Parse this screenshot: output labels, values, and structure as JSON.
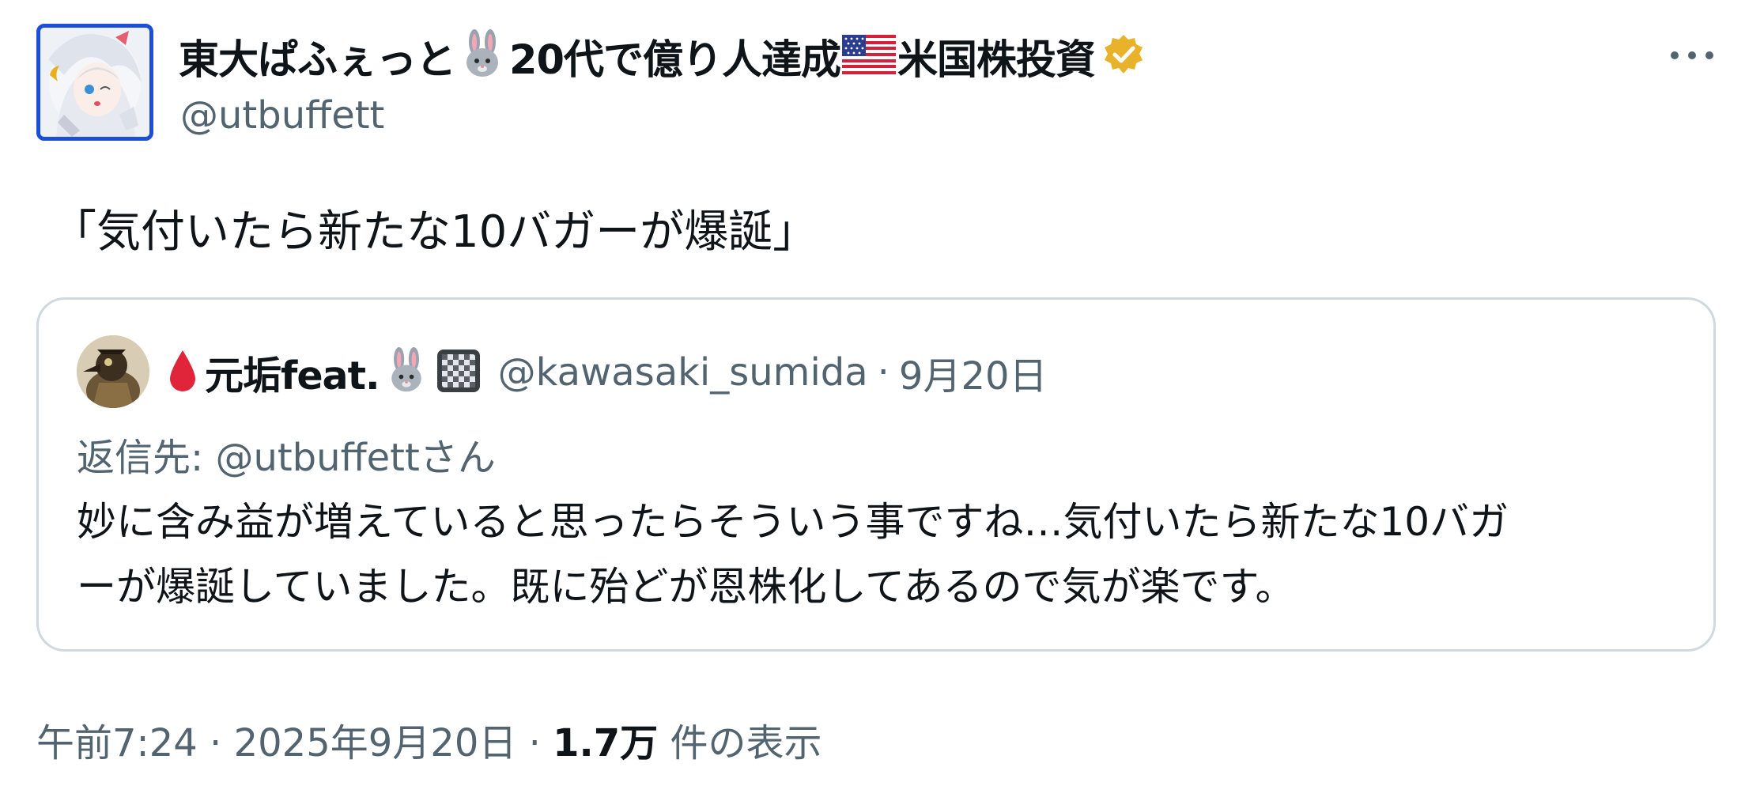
{
  "author": {
    "name_part1": "東大ぱふぇっと",
    "name_part2": "20代で億り人達成",
    "name_part3": "米国株投資",
    "handle": "@utbuffett",
    "avatar": "anime-girl-avatar",
    "verified_color": "#e8b22a"
  },
  "menu": {
    "more_label": "···"
  },
  "tweet": {
    "text": "「気付いたら新たな10バガーが爆誕」"
  },
  "quote": {
    "name": "元垢feat.",
    "handle": "@kawasaki_sumida",
    "separator": "·",
    "date": "9月20日",
    "reply_prefix": "返信先: ",
    "reply_handle": "@utbuffett",
    "reply_suffix": "さん",
    "body_line1": "妙に含み益が増えていると思ったらそういう事ですね…気付いたら新たな10バガ",
    "body_line2": "ーが爆誕していました。既に殆どが恩株化してあるので気が楽です。"
  },
  "meta": {
    "time": "午前7:24",
    "sep1": " · ",
    "date": "2025年9月20日",
    "sep2": " · ",
    "views_count": "1.7万",
    "views_label": " 件の表示"
  },
  "colors": {
    "text_primary": "#0f1419",
    "text_secondary": "#536471",
    "border": "#cfd9de",
    "avatar_border": "#1d4ed8",
    "drop_red": "#e0243a"
  }
}
